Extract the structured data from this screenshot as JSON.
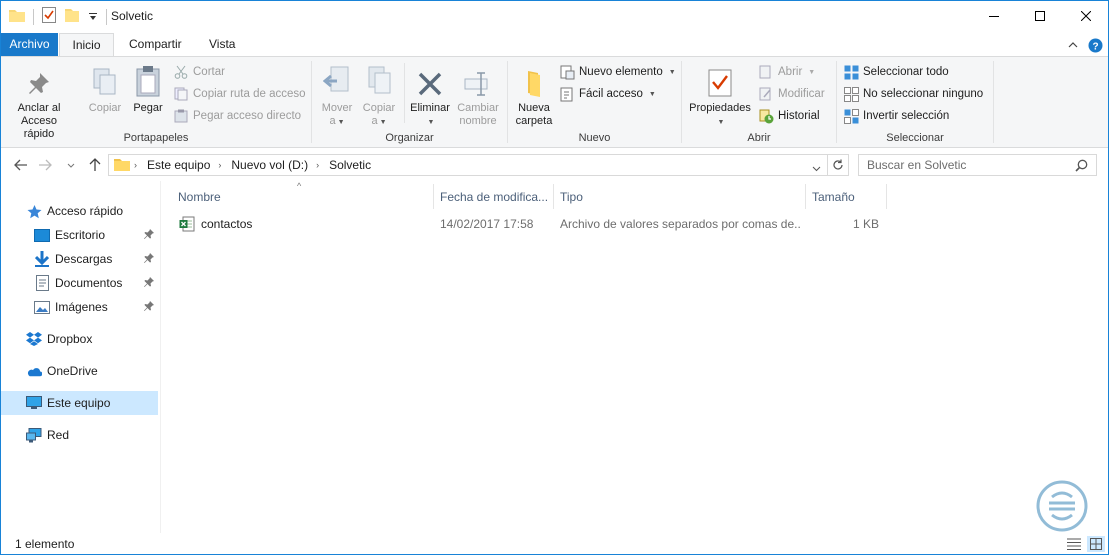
{
  "window": {
    "title": "Solvetic",
    "minimize_icon": "minimize-icon",
    "maximize_icon": "maximize-icon",
    "close_icon": "close-icon"
  },
  "tabs": {
    "file": "Archivo",
    "home": "Inicio",
    "share": "Compartir",
    "view": "Vista"
  },
  "ribbon": {
    "clipboard": {
      "label": "Portapapeles",
      "pin_quick": "Anclar al\nAcceso rápido",
      "pin_quick_l1": "Anclar al",
      "pin_quick_l2": "Acceso rápido",
      "copy": "Copiar",
      "paste": "Pegar",
      "cut": "Cortar",
      "copy_path": "Copiar ruta de acceso",
      "paste_shortcut": "Pegar acceso directo"
    },
    "organize": {
      "label": "Organizar",
      "move_l1": "Mover",
      "move_l2": "a",
      "copy_l1": "Copiar",
      "copy_l2": "a",
      "delete": "Eliminar",
      "rename_l1": "Cambiar",
      "rename_l2": "nombre"
    },
    "new": {
      "label": "Nuevo",
      "new_folder_l1": "Nueva",
      "new_folder_l2": "carpeta",
      "new_item": "Nuevo elemento",
      "easy_access": "Fácil acceso"
    },
    "open": {
      "label": "Abrir",
      "properties": "Propiedades",
      "open": "Abrir",
      "edit": "Modificar",
      "history": "Historial"
    },
    "select": {
      "label": "Seleccionar",
      "select_all": "Seleccionar todo",
      "select_none": "No seleccionar ninguno",
      "invert": "Invertir selección"
    }
  },
  "address": {
    "crumbs": [
      "Este equipo",
      "Nuevo vol (D:)",
      "Solvetic"
    ],
    "search_placeholder": "Buscar en Solvetic"
  },
  "nav": {
    "quick_access": "Acceso rápido",
    "desktop": "Escritorio",
    "downloads": "Descargas",
    "documents": "Documentos",
    "pictures": "Imágenes",
    "dropbox": "Dropbox",
    "onedrive": "OneDrive",
    "this_pc": "Este equipo",
    "network": "Red"
  },
  "columns": {
    "name": "Nombre",
    "date": "Fecha de modifica...",
    "type": "Tipo",
    "size": "Tamaño"
  },
  "files": [
    {
      "name": "contactos",
      "date": "14/02/2017 17:58",
      "type": "Archivo de valores separados por comas de...",
      "size": "1 KB",
      "icon": "excel-csv-icon"
    }
  ],
  "status": {
    "count": "1 elemento"
  },
  "colors": {
    "accent": "#1979ca",
    "selection": "#cce8ff",
    "ribbon_bg": "#f5f6f7"
  }
}
